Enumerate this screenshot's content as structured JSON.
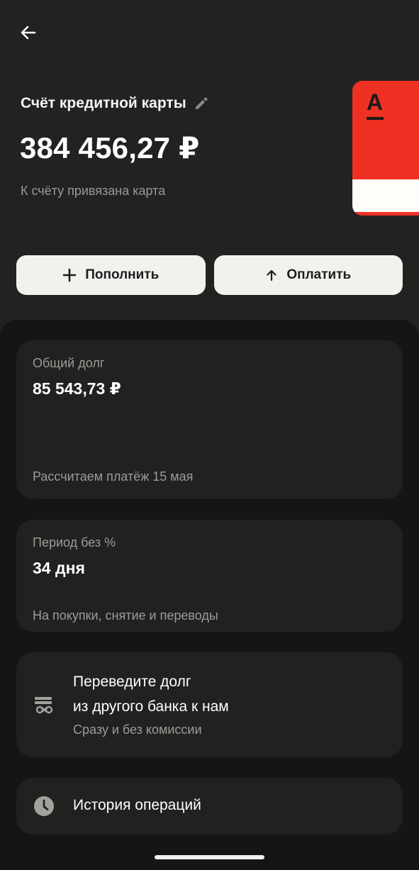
{
  "header": {
    "back_icon": "arrow-left-icon",
    "title": "Счёт кредитной карты",
    "edit_icon": "pencil-icon",
    "balance": "384 456,27 ₽",
    "card_hint": "К счёту привязана карта"
  },
  "card_thumb": {
    "logo": "А",
    "color": "#ef3124"
  },
  "actions": [
    {
      "label": "Пополнить",
      "icon": "plus-icon"
    },
    {
      "label": "Оплатить",
      "icon": "arrow-up-icon"
    }
  ],
  "debt": {
    "label": "Общий долг",
    "value": "85 543,73 ₽",
    "note": "Рассчитаем платёж 15 мая"
  },
  "period": {
    "label": "Период без %",
    "value": "34 дня",
    "note": "На покупки, снятие и переводы"
  },
  "transfer": {
    "icon": "debt-transfer-icon",
    "title_line1": "Переведите долг",
    "title_line2": "из другого банка к нам",
    "subtitle": "Сразу и без комиссии"
  },
  "history": {
    "icon": "clock-icon",
    "label": "История операций"
  }
}
